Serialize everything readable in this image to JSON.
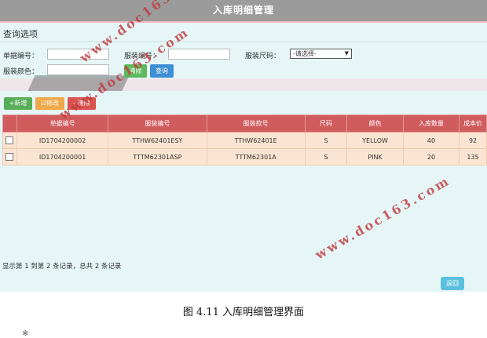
{
  "window": {
    "title": "入库明细管理"
  },
  "query": {
    "section_title": "查询选项",
    "doc_no_label": "单据编号：",
    "doc_no_value": "",
    "item_no_label": "服装编号：",
    "item_no_value": "",
    "size_label": "服装尺码：",
    "size_selected": "-请选择-",
    "color_label": "服装颜色：",
    "color_value": "",
    "clear_label": "清除",
    "query_label": "查询"
  },
  "toolbar": {
    "add_label": "+新增",
    "edit_label": "☑修改",
    "delete_label": "- 删除"
  },
  "table": {
    "columns": [
      "单据编号",
      "服装编号",
      "服装款号",
      "尺码",
      "颜色",
      "入库数量",
      "成本价"
    ],
    "rows": [
      [
        "ID1704200002",
        "TTHW62401ESY",
        "TTHW62401E",
        "S",
        "YELLOW",
        "40",
        "92"
      ],
      [
        "ID1704200001",
        "TTTM62301ASP",
        "TTTM62301A",
        "S",
        "PINK",
        "20",
        "135"
      ]
    ]
  },
  "pagination": {
    "info": "显示第 1 到第 2 条记录，总共 2 条记录"
  },
  "footer": {
    "return_label": "返回"
  },
  "watermark": {
    "text": "www.doc163.com"
  },
  "caption": {
    "text": "图 4.11 入库明细管理界面"
  },
  "stray_mark": "※",
  "colors": {
    "titlebar": "#9b9b9b",
    "table_header": "#d05c5e",
    "row_bg": "#fbe5d2",
    "page_bg": "#e6f6f6",
    "clear_button": "#5cb85c",
    "query_button": "#3e8fd4",
    "add_button": "#58ae58",
    "edit_button": "#efa84a",
    "delete_button": "#d9534f",
    "return_button": "#5bc0de",
    "watermark": "#c0393e"
  }
}
